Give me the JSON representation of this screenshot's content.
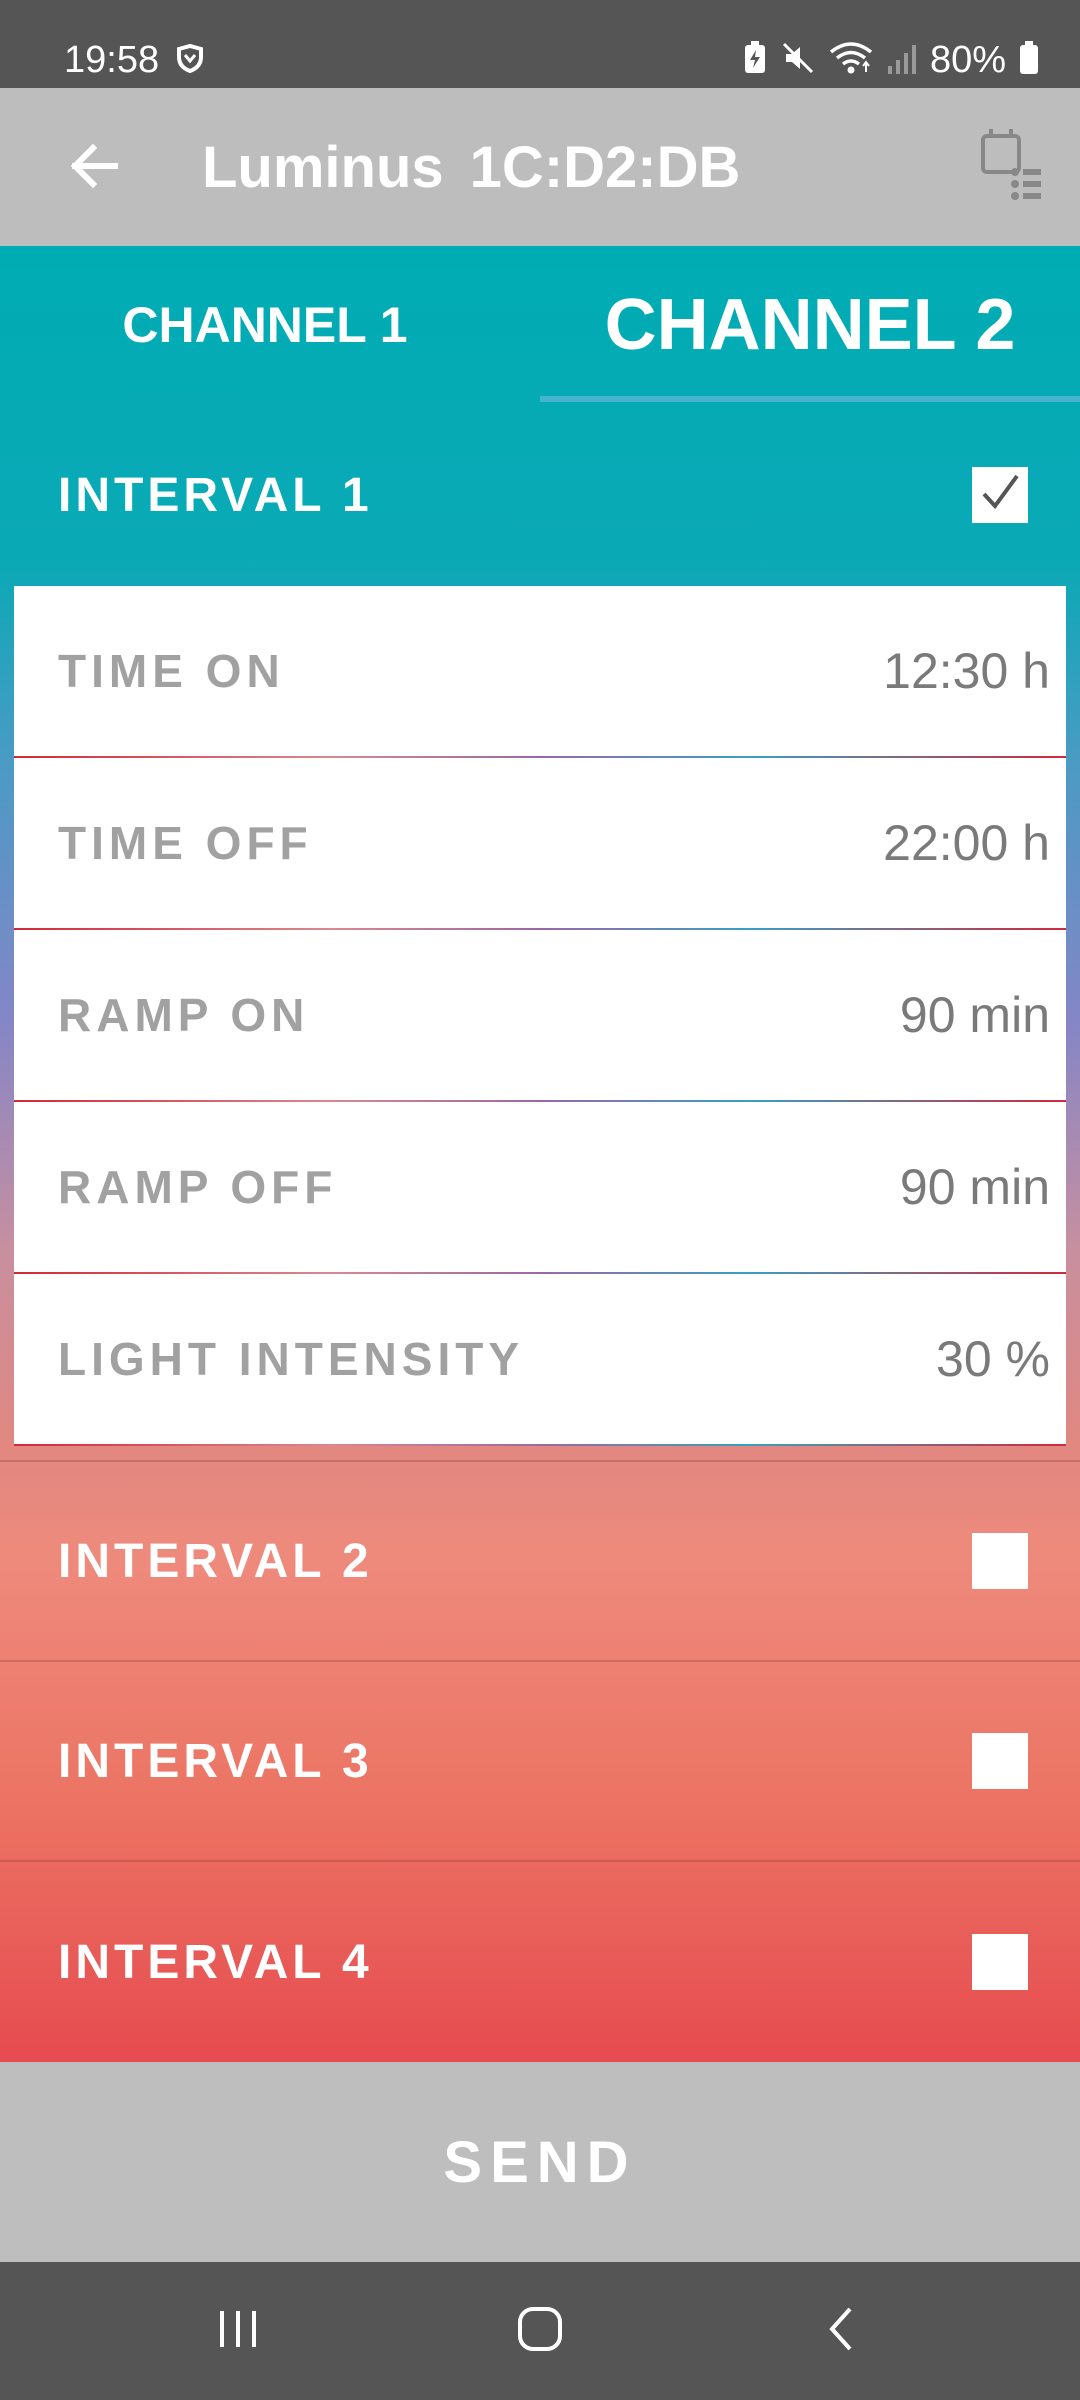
{
  "status_bar": {
    "time": "19:58",
    "battery": "80%",
    "icons": [
      "shield-icon",
      "battery-saver-icon",
      "mute-icon",
      "wifi-icon",
      "signal-icon",
      "battery-icon"
    ]
  },
  "app_bar": {
    "title_name": "Luminus",
    "title_device": "1C:D2:DB",
    "back_icon": "arrow-left-icon",
    "device_icon": "device-list-icon"
  },
  "tabs": [
    {
      "label": "CHANNEL 1",
      "selected": false
    },
    {
      "label": "CHANNEL 2",
      "selected": true
    }
  ],
  "intervals": [
    {
      "label": "INTERVAL 1",
      "checked": true
    },
    {
      "label": "INTERVAL 2",
      "checked": false
    },
    {
      "label": "INTERVAL 3",
      "checked": false
    },
    {
      "label": "INTERVAL 4",
      "checked": false
    }
  ],
  "interval1_settings": [
    {
      "label": "TIME ON",
      "value": "12:30 h"
    },
    {
      "label": "TIME OFF",
      "value": "22:00 h"
    },
    {
      "label": "RAMP ON",
      "value": "90 min"
    },
    {
      "label": "RAMP OFF",
      "value": "90 min"
    },
    {
      "label": "LIGHT INTENSITY",
      "value": "30 %"
    }
  ],
  "send_label": "SEND",
  "colors": {
    "accent_teal": "#00acb4",
    "accent_red": "#e64b4f",
    "bar_gray": "#bdbdbd",
    "system_bar": "#555555"
  }
}
